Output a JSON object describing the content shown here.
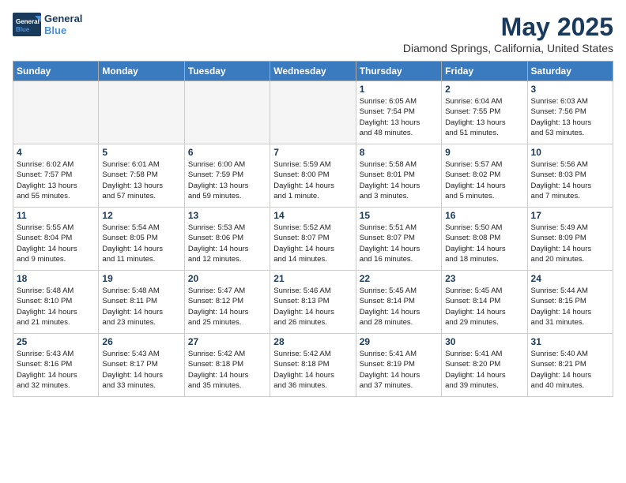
{
  "header": {
    "logo_general": "General",
    "logo_blue": "Blue",
    "month": "May 2025",
    "location": "Diamond Springs, California, United States"
  },
  "days_of_week": [
    "Sunday",
    "Monday",
    "Tuesday",
    "Wednesday",
    "Thursday",
    "Friday",
    "Saturday"
  ],
  "weeks": [
    [
      {
        "day": "",
        "info": ""
      },
      {
        "day": "",
        "info": ""
      },
      {
        "day": "",
        "info": ""
      },
      {
        "day": "",
        "info": ""
      },
      {
        "day": "1",
        "info": "Sunrise: 6:05 AM\nSunset: 7:54 PM\nDaylight: 13 hours\nand 48 minutes."
      },
      {
        "day": "2",
        "info": "Sunrise: 6:04 AM\nSunset: 7:55 PM\nDaylight: 13 hours\nand 51 minutes."
      },
      {
        "day": "3",
        "info": "Sunrise: 6:03 AM\nSunset: 7:56 PM\nDaylight: 13 hours\nand 53 minutes."
      }
    ],
    [
      {
        "day": "4",
        "info": "Sunrise: 6:02 AM\nSunset: 7:57 PM\nDaylight: 13 hours\nand 55 minutes."
      },
      {
        "day": "5",
        "info": "Sunrise: 6:01 AM\nSunset: 7:58 PM\nDaylight: 13 hours\nand 57 minutes."
      },
      {
        "day": "6",
        "info": "Sunrise: 6:00 AM\nSunset: 7:59 PM\nDaylight: 13 hours\nand 59 minutes."
      },
      {
        "day": "7",
        "info": "Sunrise: 5:59 AM\nSunset: 8:00 PM\nDaylight: 14 hours\nand 1 minute."
      },
      {
        "day": "8",
        "info": "Sunrise: 5:58 AM\nSunset: 8:01 PM\nDaylight: 14 hours\nand 3 minutes."
      },
      {
        "day": "9",
        "info": "Sunrise: 5:57 AM\nSunset: 8:02 PM\nDaylight: 14 hours\nand 5 minutes."
      },
      {
        "day": "10",
        "info": "Sunrise: 5:56 AM\nSunset: 8:03 PM\nDaylight: 14 hours\nand 7 minutes."
      }
    ],
    [
      {
        "day": "11",
        "info": "Sunrise: 5:55 AM\nSunset: 8:04 PM\nDaylight: 14 hours\nand 9 minutes."
      },
      {
        "day": "12",
        "info": "Sunrise: 5:54 AM\nSunset: 8:05 PM\nDaylight: 14 hours\nand 11 minutes."
      },
      {
        "day": "13",
        "info": "Sunrise: 5:53 AM\nSunset: 8:06 PM\nDaylight: 14 hours\nand 12 minutes."
      },
      {
        "day": "14",
        "info": "Sunrise: 5:52 AM\nSunset: 8:07 PM\nDaylight: 14 hours\nand 14 minutes."
      },
      {
        "day": "15",
        "info": "Sunrise: 5:51 AM\nSunset: 8:07 PM\nDaylight: 14 hours\nand 16 minutes."
      },
      {
        "day": "16",
        "info": "Sunrise: 5:50 AM\nSunset: 8:08 PM\nDaylight: 14 hours\nand 18 minutes."
      },
      {
        "day": "17",
        "info": "Sunrise: 5:49 AM\nSunset: 8:09 PM\nDaylight: 14 hours\nand 20 minutes."
      }
    ],
    [
      {
        "day": "18",
        "info": "Sunrise: 5:48 AM\nSunset: 8:10 PM\nDaylight: 14 hours\nand 21 minutes."
      },
      {
        "day": "19",
        "info": "Sunrise: 5:48 AM\nSunset: 8:11 PM\nDaylight: 14 hours\nand 23 minutes."
      },
      {
        "day": "20",
        "info": "Sunrise: 5:47 AM\nSunset: 8:12 PM\nDaylight: 14 hours\nand 25 minutes."
      },
      {
        "day": "21",
        "info": "Sunrise: 5:46 AM\nSunset: 8:13 PM\nDaylight: 14 hours\nand 26 minutes."
      },
      {
        "day": "22",
        "info": "Sunrise: 5:45 AM\nSunset: 8:14 PM\nDaylight: 14 hours\nand 28 minutes."
      },
      {
        "day": "23",
        "info": "Sunrise: 5:45 AM\nSunset: 8:14 PM\nDaylight: 14 hours\nand 29 minutes."
      },
      {
        "day": "24",
        "info": "Sunrise: 5:44 AM\nSunset: 8:15 PM\nDaylight: 14 hours\nand 31 minutes."
      }
    ],
    [
      {
        "day": "25",
        "info": "Sunrise: 5:43 AM\nSunset: 8:16 PM\nDaylight: 14 hours\nand 32 minutes."
      },
      {
        "day": "26",
        "info": "Sunrise: 5:43 AM\nSunset: 8:17 PM\nDaylight: 14 hours\nand 33 minutes."
      },
      {
        "day": "27",
        "info": "Sunrise: 5:42 AM\nSunset: 8:18 PM\nDaylight: 14 hours\nand 35 minutes."
      },
      {
        "day": "28",
        "info": "Sunrise: 5:42 AM\nSunset: 8:18 PM\nDaylight: 14 hours\nand 36 minutes."
      },
      {
        "day": "29",
        "info": "Sunrise: 5:41 AM\nSunset: 8:19 PM\nDaylight: 14 hours\nand 37 minutes."
      },
      {
        "day": "30",
        "info": "Sunrise: 5:41 AM\nSunset: 8:20 PM\nDaylight: 14 hours\nand 39 minutes."
      },
      {
        "day": "31",
        "info": "Sunrise: 5:40 AM\nSunset: 8:21 PM\nDaylight: 14 hours\nand 40 minutes."
      }
    ]
  ]
}
